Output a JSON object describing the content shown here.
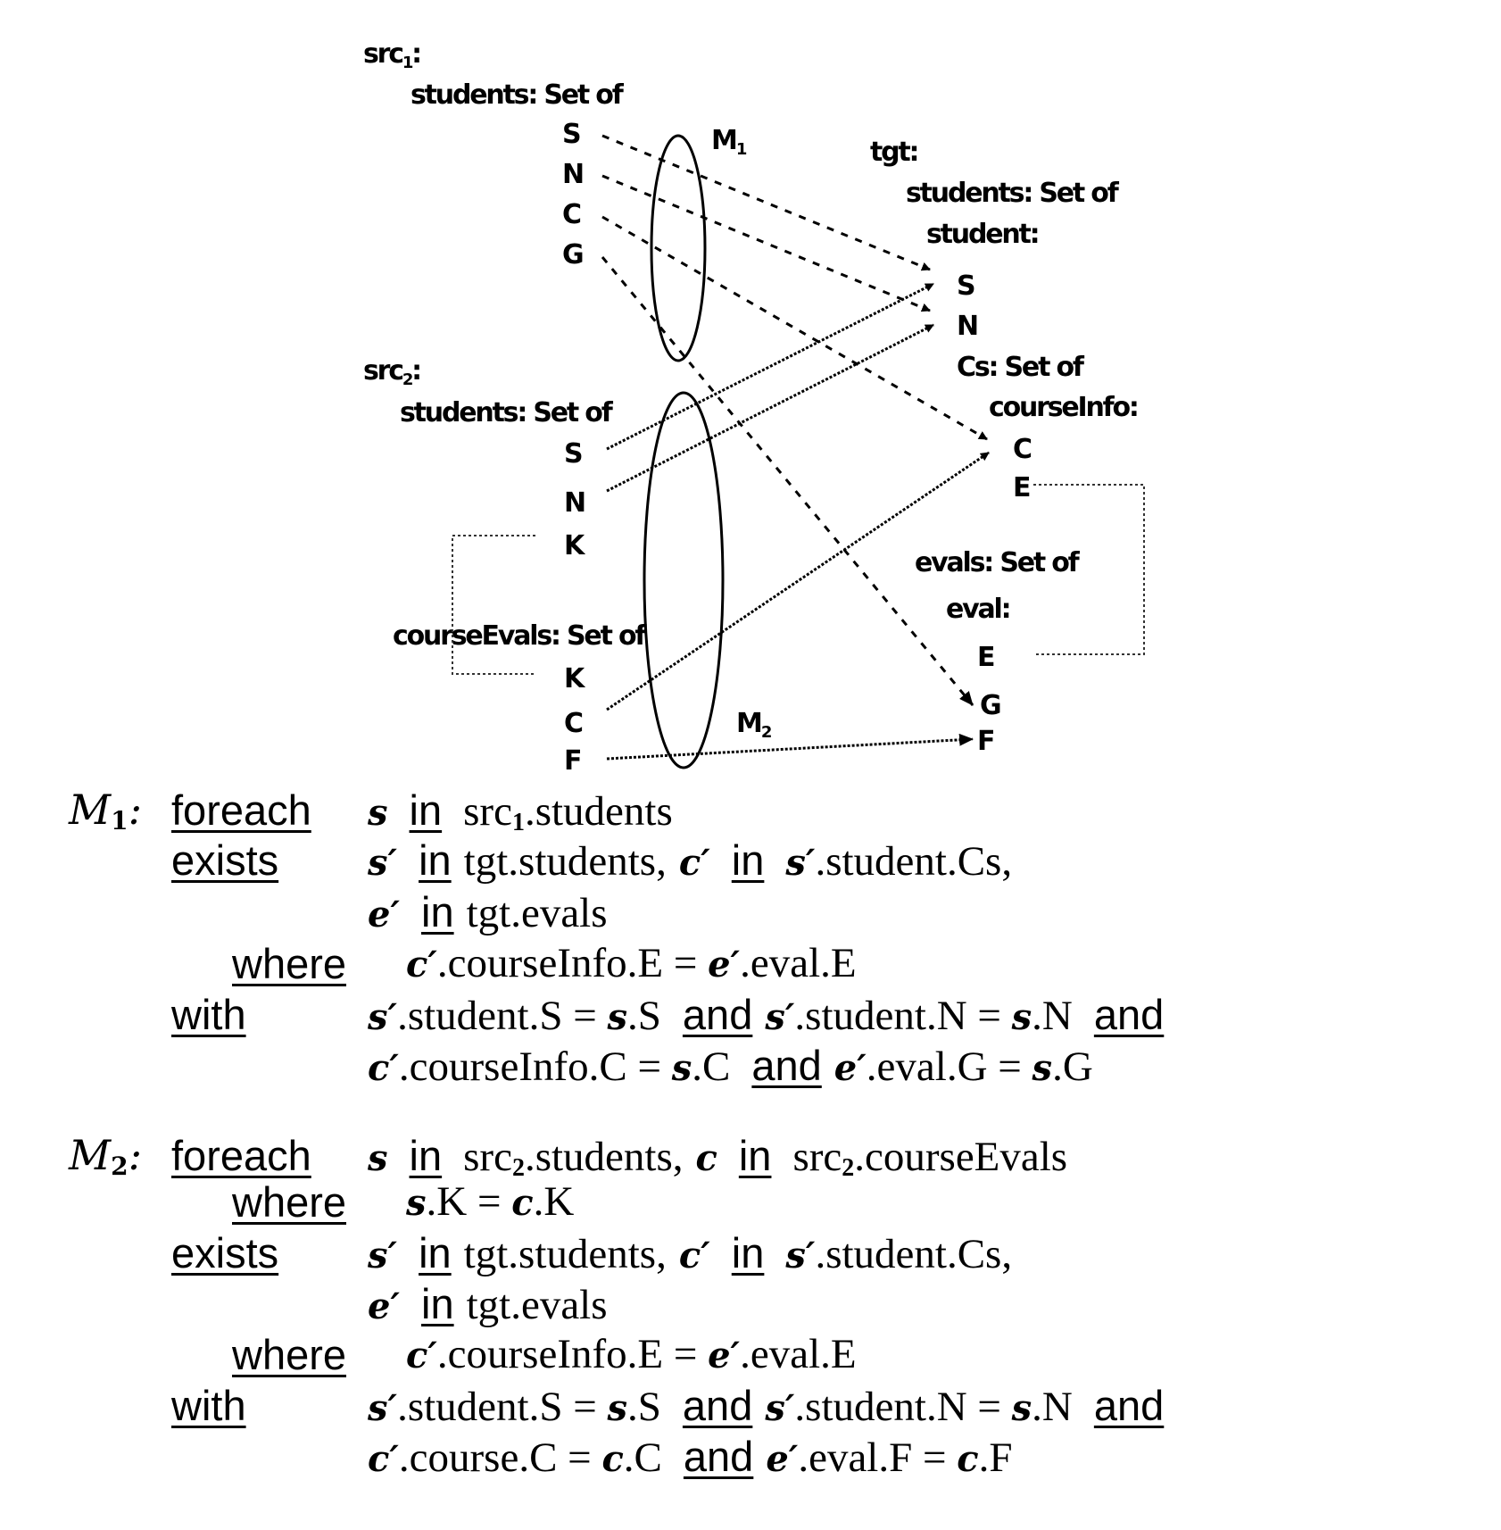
{
  "diagram": {
    "src1": {
      "name": "src",
      "subscript": "1",
      "colon": ":",
      "set_label": "students: Set of",
      "fields": [
        "S",
        "N",
        "C",
        "G"
      ]
    },
    "src2": {
      "name": "src",
      "subscript": "2",
      "colon": ":",
      "students_set_label": "students: Set of",
      "students_fields": [
        "S",
        "N",
        "K"
      ],
      "courseEvals_set_label": "courseEvals: Set of",
      "courseEvals_fields": [
        "K",
        "C",
        "F"
      ]
    },
    "tgt": {
      "name": "tgt:",
      "students_set_label": "students: Set of",
      "student_label": "student:",
      "student_fields": [
        "S",
        "N"
      ],
      "cs_set_label": "Cs: Set of",
      "courseInfo_label": "courseInfo:",
      "courseInfo_fields": [
        "C",
        "E"
      ],
      "evals_set_label": "evals: Set of",
      "eval_label": "eval:",
      "eval_fields": [
        "E",
        "G",
        "F"
      ]
    },
    "mappings": [
      {
        "name": "M",
        "subscript": "1",
        "line_style": "dashed",
        "correspondences": [
          [
            "src1.S",
            "tgt.S"
          ],
          [
            "src1.N",
            "tgt.N"
          ],
          [
            "src1.C",
            "tgt.C"
          ],
          [
            "src1.G",
            "tgt.G"
          ]
        ]
      },
      {
        "name": "M",
        "subscript": "2",
        "line_style": "dotted",
        "correspondences": [
          [
            "src2.S",
            "tgt.S"
          ],
          [
            "src2.N",
            "tgt.N"
          ],
          [
            "src2.C",
            "tgt.C"
          ],
          [
            "src2.F",
            "tgt.F"
          ]
        ]
      }
    ],
    "foreign_keys": [
      [
        "src2.students.K",
        "src2.courseEvals.K"
      ],
      [
        "tgt.courseInfo.E",
        "tgt.eval.E"
      ]
    ]
  },
  "rules": {
    "m1": {
      "name": "M",
      "sub": "1",
      "colon": ":",
      "foreach_kw": "foreach",
      "foreach": {
        "var": "s",
        "in": "in",
        "src": "src",
        "src_sub": "1",
        "path": ".students"
      },
      "exists_kw": "exists",
      "exists_line1": {
        "v1": "s′",
        "in1": "in",
        "p1": "tgt.students,",
        "v2": "c′",
        "in2": "in",
        "v3": "s′",
        "p2": ".student.Cs,"
      },
      "exists_line2": {
        "v1": "e′",
        "in1": "in",
        "p1": "tgt.evals"
      },
      "where_kw": "where",
      "where": {
        "v1": "c′",
        "p1": ".courseInfo.E = ",
        "v2": "e′",
        "p2": ".eval.E"
      },
      "with_kw": "with",
      "with_line1": {
        "v1": "s′",
        "p1": ".student.S = ",
        "v2": "s",
        "p2": ".S",
        "and1": "and",
        "v3": "s′",
        "p3": ".student.N = ",
        "v4": "s",
        "p4": ".N",
        "and2": "and"
      },
      "with_line2": {
        "v1": "c′",
        "p1": ".courseInfo.C = ",
        "v2": "s",
        "p2": ".C",
        "and1": "and",
        "v3": "e′",
        "p3": ".eval.G = ",
        "v4": "s",
        "p4": ".G"
      }
    },
    "m2": {
      "name": "M",
      "sub": "2",
      "colon": ":",
      "foreach_kw": "foreach",
      "foreach": {
        "var": "s",
        "in": "in",
        "src": "src",
        "src_sub": "2",
        "path": ".students,",
        "var2": "c",
        "in2": "in",
        "src2": "src",
        "src2_sub": "2",
        "path2": ".courseEvals"
      },
      "where1_kw": "where",
      "where1": {
        "v1": "s",
        "p1": ".K = ",
        "v2": "c",
        "p2": ".K"
      },
      "exists_kw": "exists",
      "exists_line1": {
        "v1": "s′",
        "in1": "in",
        "p1": "tgt.students,",
        "v2": "c′",
        "in2": "in",
        "v3": "s′",
        "p2": ".student.Cs,"
      },
      "exists_line2": {
        "v1": "e′",
        "in1": "in",
        "p1": "tgt.evals"
      },
      "where_kw": "where",
      "where": {
        "v1": "c′",
        "p1": ".courseInfo.E = ",
        "v2": "e′",
        "p2": ".eval.E"
      },
      "with_kw": "with",
      "with_line1": {
        "v1": "s′",
        "p1": ".student.S = ",
        "v2": "s",
        "p2": ".S",
        "and1": "and",
        "v3": "s′",
        "p3": ".student.N = ",
        "v4": "s",
        "p4": ".N",
        "and2": "and"
      },
      "with_line2": {
        "v1": "c′",
        "p1": ".course.C = ",
        "v2": "c",
        "p2": ".C",
        "and1": "and",
        "v3": "e′",
        "p3": ".eval.F = ",
        "v4": "c",
        "p4": ".F"
      }
    }
  }
}
